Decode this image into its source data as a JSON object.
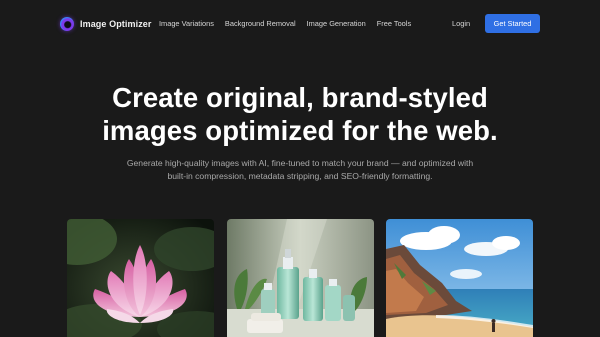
{
  "app": {
    "brand_name": "Image Optimizer",
    "brand_colors": {
      "accent": "#7c3aed",
      "primary": "#2f6fe4",
      "background": "#1a1a1a"
    }
  },
  "nav": {
    "links": [
      {
        "label": "Image Variations"
      },
      {
        "label": "Background Removal"
      },
      {
        "label": "Image Generation"
      },
      {
        "label": "Free Tools"
      }
    ],
    "login_label": "Login",
    "cta_label": "Get Started"
  },
  "hero": {
    "title_line1": "Create original, brand-styled",
    "title_line2": "images optimized for the web.",
    "subtitle": "Generate high-quality images with AI, fine-tuned to match your brand — and optimized with built-in compression, metadata stripping, and SEO-friendly formatting."
  },
  "gallery": [
    {
      "icon": "lotus-image"
    },
    {
      "icon": "cosmetic-bottles-image"
    },
    {
      "icon": "coastal-beach-image"
    }
  ]
}
